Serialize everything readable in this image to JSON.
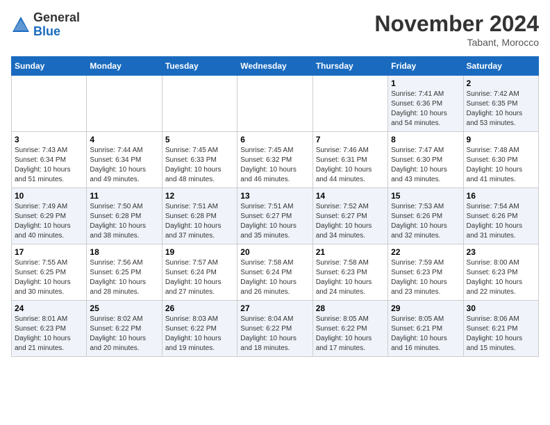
{
  "header": {
    "logo_line1": "General",
    "logo_line2": "Blue",
    "month": "November 2024",
    "location": "Tabant, Morocco"
  },
  "weekdays": [
    "Sunday",
    "Monday",
    "Tuesday",
    "Wednesday",
    "Thursday",
    "Friday",
    "Saturday"
  ],
  "weeks": [
    [
      {
        "day": "",
        "info": ""
      },
      {
        "day": "",
        "info": ""
      },
      {
        "day": "",
        "info": ""
      },
      {
        "day": "",
        "info": ""
      },
      {
        "day": "",
        "info": ""
      },
      {
        "day": "1",
        "info": "Sunrise: 7:41 AM\nSunset: 6:36 PM\nDaylight: 10 hours\nand 54 minutes."
      },
      {
        "day": "2",
        "info": "Sunrise: 7:42 AM\nSunset: 6:35 PM\nDaylight: 10 hours\nand 53 minutes."
      }
    ],
    [
      {
        "day": "3",
        "info": "Sunrise: 7:43 AM\nSunset: 6:34 PM\nDaylight: 10 hours\nand 51 minutes."
      },
      {
        "day": "4",
        "info": "Sunrise: 7:44 AM\nSunset: 6:34 PM\nDaylight: 10 hours\nand 49 minutes."
      },
      {
        "day": "5",
        "info": "Sunrise: 7:45 AM\nSunset: 6:33 PM\nDaylight: 10 hours\nand 48 minutes."
      },
      {
        "day": "6",
        "info": "Sunrise: 7:45 AM\nSunset: 6:32 PM\nDaylight: 10 hours\nand 46 minutes."
      },
      {
        "day": "7",
        "info": "Sunrise: 7:46 AM\nSunset: 6:31 PM\nDaylight: 10 hours\nand 44 minutes."
      },
      {
        "day": "8",
        "info": "Sunrise: 7:47 AM\nSunset: 6:30 PM\nDaylight: 10 hours\nand 43 minutes."
      },
      {
        "day": "9",
        "info": "Sunrise: 7:48 AM\nSunset: 6:30 PM\nDaylight: 10 hours\nand 41 minutes."
      }
    ],
    [
      {
        "day": "10",
        "info": "Sunrise: 7:49 AM\nSunset: 6:29 PM\nDaylight: 10 hours\nand 40 minutes."
      },
      {
        "day": "11",
        "info": "Sunrise: 7:50 AM\nSunset: 6:28 PM\nDaylight: 10 hours\nand 38 minutes."
      },
      {
        "day": "12",
        "info": "Sunrise: 7:51 AM\nSunset: 6:28 PM\nDaylight: 10 hours\nand 37 minutes."
      },
      {
        "day": "13",
        "info": "Sunrise: 7:51 AM\nSunset: 6:27 PM\nDaylight: 10 hours\nand 35 minutes."
      },
      {
        "day": "14",
        "info": "Sunrise: 7:52 AM\nSunset: 6:27 PM\nDaylight: 10 hours\nand 34 minutes."
      },
      {
        "day": "15",
        "info": "Sunrise: 7:53 AM\nSunset: 6:26 PM\nDaylight: 10 hours\nand 32 minutes."
      },
      {
        "day": "16",
        "info": "Sunrise: 7:54 AM\nSunset: 6:26 PM\nDaylight: 10 hours\nand 31 minutes."
      }
    ],
    [
      {
        "day": "17",
        "info": "Sunrise: 7:55 AM\nSunset: 6:25 PM\nDaylight: 10 hours\nand 30 minutes."
      },
      {
        "day": "18",
        "info": "Sunrise: 7:56 AM\nSunset: 6:25 PM\nDaylight: 10 hours\nand 28 minutes."
      },
      {
        "day": "19",
        "info": "Sunrise: 7:57 AM\nSunset: 6:24 PM\nDaylight: 10 hours\nand 27 minutes."
      },
      {
        "day": "20",
        "info": "Sunrise: 7:58 AM\nSunset: 6:24 PM\nDaylight: 10 hours\nand 26 minutes."
      },
      {
        "day": "21",
        "info": "Sunrise: 7:58 AM\nSunset: 6:23 PM\nDaylight: 10 hours\nand 24 minutes."
      },
      {
        "day": "22",
        "info": "Sunrise: 7:59 AM\nSunset: 6:23 PM\nDaylight: 10 hours\nand 23 minutes."
      },
      {
        "day": "23",
        "info": "Sunrise: 8:00 AM\nSunset: 6:23 PM\nDaylight: 10 hours\nand 22 minutes."
      }
    ],
    [
      {
        "day": "24",
        "info": "Sunrise: 8:01 AM\nSunset: 6:23 PM\nDaylight: 10 hours\nand 21 minutes."
      },
      {
        "day": "25",
        "info": "Sunrise: 8:02 AM\nSunset: 6:22 PM\nDaylight: 10 hours\nand 20 minutes."
      },
      {
        "day": "26",
        "info": "Sunrise: 8:03 AM\nSunset: 6:22 PM\nDaylight: 10 hours\nand 19 minutes."
      },
      {
        "day": "27",
        "info": "Sunrise: 8:04 AM\nSunset: 6:22 PM\nDaylight: 10 hours\nand 18 minutes."
      },
      {
        "day": "28",
        "info": "Sunrise: 8:05 AM\nSunset: 6:22 PM\nDaylight: 10 hours\nand 17 minutes."
      },
      {
        "day": "29",
        "info": "Sunrise: 8:05 AM\nSunset: 6:21 PM\nDaylight: 10 hours\nand 16 minutes."
      },
      {
        "day": "30",
        "info": "Sunrise: 8:06 AM\nSunset: 6:21 PM\nDaylight: 10 hours\nand 15 minutes."
      }
    ]
  ]
}
